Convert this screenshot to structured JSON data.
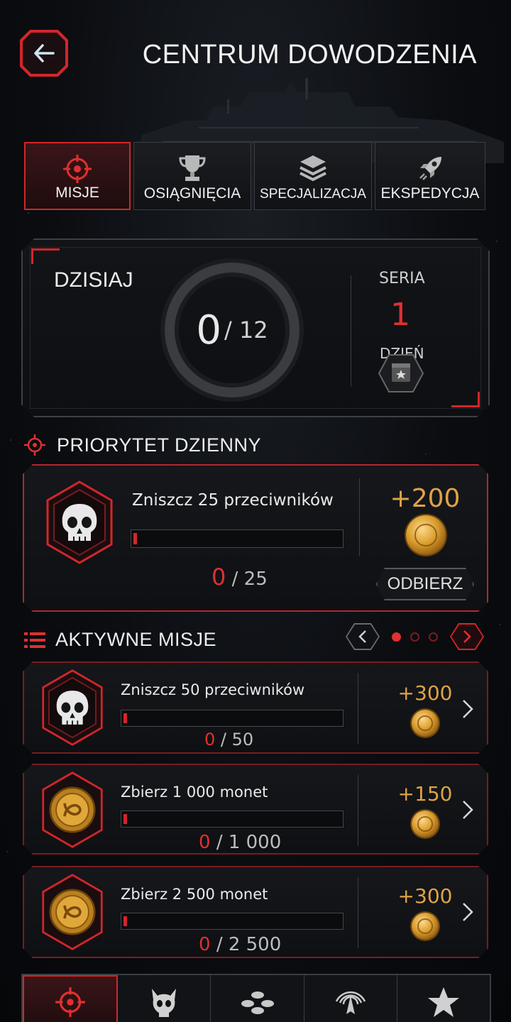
{
  "header": {
    "title": "CENTRUM DOWODZENIA"
  },
  "tabs": [
    {
      "label": "MISJE",
      "icon": "crosshair-icon",
      "active": true
    },
    {
      "label": "OSIĄGNIĘCIA",
      "icon": "trophy-icon",
      "active": false
    },
    {
      "label": "SPECJALIZACJA",
      "icon": "layers-icon",
      "active": false
    },
    {
      "label": "EKSPEDYCJA",
      "icon": "rocket-icon",
      "active": false
    }
  ],
  "today": {
    "label": "DZISIAJ",
    "completed": "0",
    "total": "/ 12",
    "streak_label": "SERIA",
    "streak_value": "1",
    "streak_unit": "DZIEŃ"
  },
  "daily_priority": {
    "title": "PRIORYTET DZIENNY",
    "mission": "Zniszcz 25 przeciwników",
    "progress_current": "0",
    "progress_total": "/ 25",
    "progress_fraction": 0.0,
    "reward": "+200",
    "claim_label": "ODBIERZ",
    "icon": "skull-icon"
  },
  "active_missions": {
    "title": "AKTYWNE MISJE",
    "page": 1,
    "pages": 3,
    "items": [
      {
        "mission": "Zniszcz 50 przeciwników",
        "current": "0",
        "total": "/ 50",
        "reward": "+300",
        "icon": "skull-icon"
      },
      {
        "mission": "Zbierz 1 000 monet",
        "current": "0",
        "total": "/ 1 000",
        "reward": "+150",
        "icon": "coin-icon"
      },
      {
        "mission": "Zbierz 2 500 monet",
        "current": "0",
        "total": "/ 2 500",
        "reward": "+300",
        "icon": "coin-icon"
      }
    ]
  },
  "bottom_nav": [
    {
      "icon": "crosshair-icon",
      "active": true
    },
    {
      "icon": "demon-skull-icon",
      "active": false
    },
    {
      "icon": "chips-icon",
      "active": false
    },
    {
      "icon": "radar-ship-icon",
      "active": false
    },
    {
      "icon": "star-icon",
      "active": false
    }
  ],
  "colors": {
    "accent": "#d3262a",
    "reward": "#e0a345",
    "background": "#0b0d11"
  }
}
